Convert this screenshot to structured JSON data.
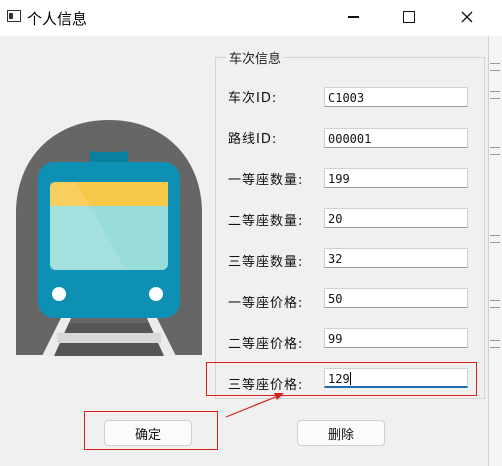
{
  "window": {
    "title": "个人信息"
  },
  "group": {
    "title": "车次信息"
  },
  "fields": [
    {
      "label": "车次ID:",
      "value": "C1003"
    },
    {
      "label": "路线ID:",
      "value": "000001"
    },
    {
      "label": "一等座数量:",
      "value": "199"
    },
    {
      "label": "二等座数量:",
      "value": "20"
    },
    {
      "label": "三等座数量:",
      "value": "32"
    },
    {
      "label": "一等座价格:",
      "value": "50"
    },
    {
      "label": "二等座价格:",
      "value": "99"
    },
    {
      "label": "三等座价格:",
      "value": "129"
    }
  ],
  "buttons": {
    "confirm": "确定",
    "delete": "删除"
  },
  "colors": {
    "accent": "#1f6fb5",
    "annotation": "#d9201b",
    "train_body": "#0e8fb4",
    "tunnel": "#666666"
  }
}
